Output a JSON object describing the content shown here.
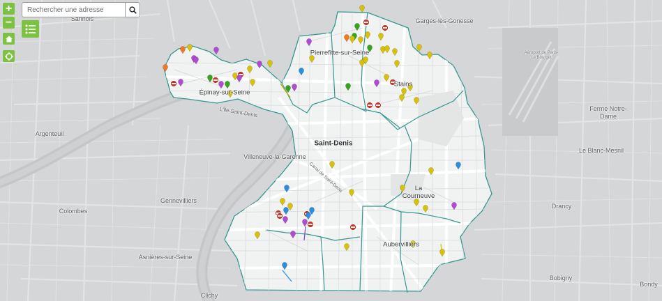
{
  "search": {
    "placeholder": "Rechercher une adresse"
  },
  "controls": {
    "zoom_in": "+",
    "zoom_out": "−",
    "home_icon": "home-icon",
    "locate_icon": "locate-icon",
    "layers_icon": "list-icon"
  },
  "colors": {
    "accent": "#7bc241",
    "boundary": "#35968f",
    "territory_fill": "#f1f2f2",
    "marker_yellow": "#d6c20a",
    "marker_purple": "#b04bd2",
    "marker_green": "#35a51e",
    "marker_blue": "#2b8fe0",
    "marker_orange": "#ee7a25",
    "marker_forbidden": "#c0392b"
  },
  "places": {
    "sannois": "Sannois",
    "garges": "Garges-lès-Gonesse",
    "pierrefitte": "Pierrefitte-sur-Seine",
    "airport": "Aéroport de Paris-Le Bourget",
    "epinay": "Épinay-sur-Seine",
    "stains": "Stains",
    "ile_saint_denis": "L'Île-Saint-Denis",
    "argenteuil": "Argenteuil",
    "ferme": "Ferme Notre-Dame",
    "saint_denis": "Saint-Denis",
    "villeneuve": "Villeneuve-la-Garenne",
    "le_blanc_mesnil": "Le Blanc-Mesnil",
    "canal": "Canal de Saint-Denis",
    "la_courneuve": "La Courneuve",
    "gennevilliers": "Gennevilliers",
    "drancy": "Drancy",
    "colombes": "Colombes",
    "aubervilliers": "Aubervilliers",
    "asnieres": "Asnières-sur-Seine",
    "bobigny": "Bobigny",
    "clichy": "Clichy",
    "bondy": "Bondy"
  }
}
